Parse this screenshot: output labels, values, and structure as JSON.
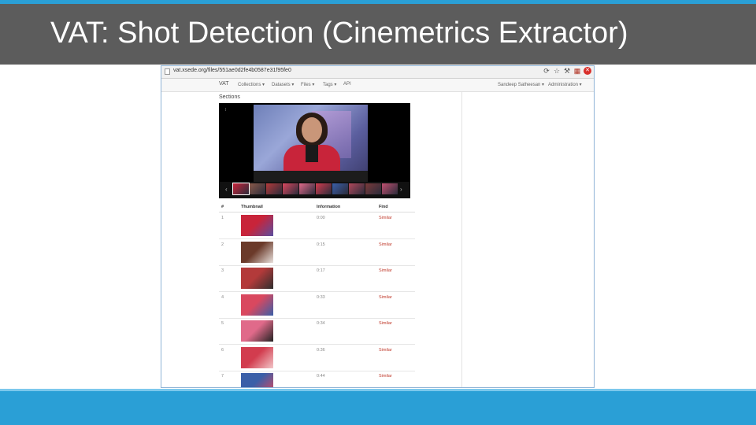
{
  "slide": {
    "title": "VAT: Shot Detection (Cinemetrics Extractor)"
  },
  "browser": {
    "url": "vat.xsede.org/files/551ae0d2fe4b0587e31f95fe0",
    "icons": [
      "page-icon",
      "refresh-icon",
      "star-icon",
      "wrench-icon",
      "apps-icon",
      "stop-icon"
    ]
  },
  "navbar": {
    "brand": "VAT",
    "items": [
      "Collections ▾",
      "Datasets ▾",
      "Files ▾",
      "Tags ▾",
      "API"
    ],
    "user": "Sandeep Satheesan ▾",
    "admin": "Administration ▾"
  },
  "sections": {
    "title": "Sections"
  },
  "player": {
    "corner_mark": "⁞"
  },
  "table": {
    "headers": [
      "#",
      "Thumbnail",
      "Information",
      "Find"
    ],
    "rows": [
      {
        "num": "1",
        "info": "0:00",
        "find": "Similar",
        "colors": [
          "#c8243a",
          "#5a4ea0"
        ]
      },
      {
        "num": "2",
        "info": "0:15",
        "find": "Similar",
        "colors": [
          "#6b3a2a",
          "#e8e0dc"
        ]
      },
      {
        "num": "3",
        "info": "0:17",
        "find": "Similar",
        "colors": [
          "#b33a3a",
          "#2e2e2e"
        ]
      },
      {
        "num": "4",
        "info": "0:33",
        "find": "Similar",
        "colors": [
          "#d9485f",
          "#3a5fa8"
        ]
      },
      {
        "num": "5",
        "info": "0:34",
        "find": "Similar",
        "colors": [
          "#e06a8a",
          "#222222"
        ]
      },
      {
        "num": "6",
        "info": "0:36",
        "find": "Similar",
        "colors": [
          "#d23c4e",
          "#f2c6c9"
        ]
      },
      {
        "num": "7",
        "info": "0:44",
        "find": "Similar",
        "colors": [
          "#3a5fa8",
          "#d9485f"
        ]
      }
    ]
  },
  "filmstrip": {
    "prev": "‹",
    "next": "›",
    "colors": [
      "#c8243a",
      "#8a5a4a",
      "#b33a3a",
      "#d9485f",
      "#e06a8a",
      "#d23c4e",
      "#3a5fa8",
      "#b0485a",
      "#7a3a3a",
      "#c05070"
    ]
  }
}
